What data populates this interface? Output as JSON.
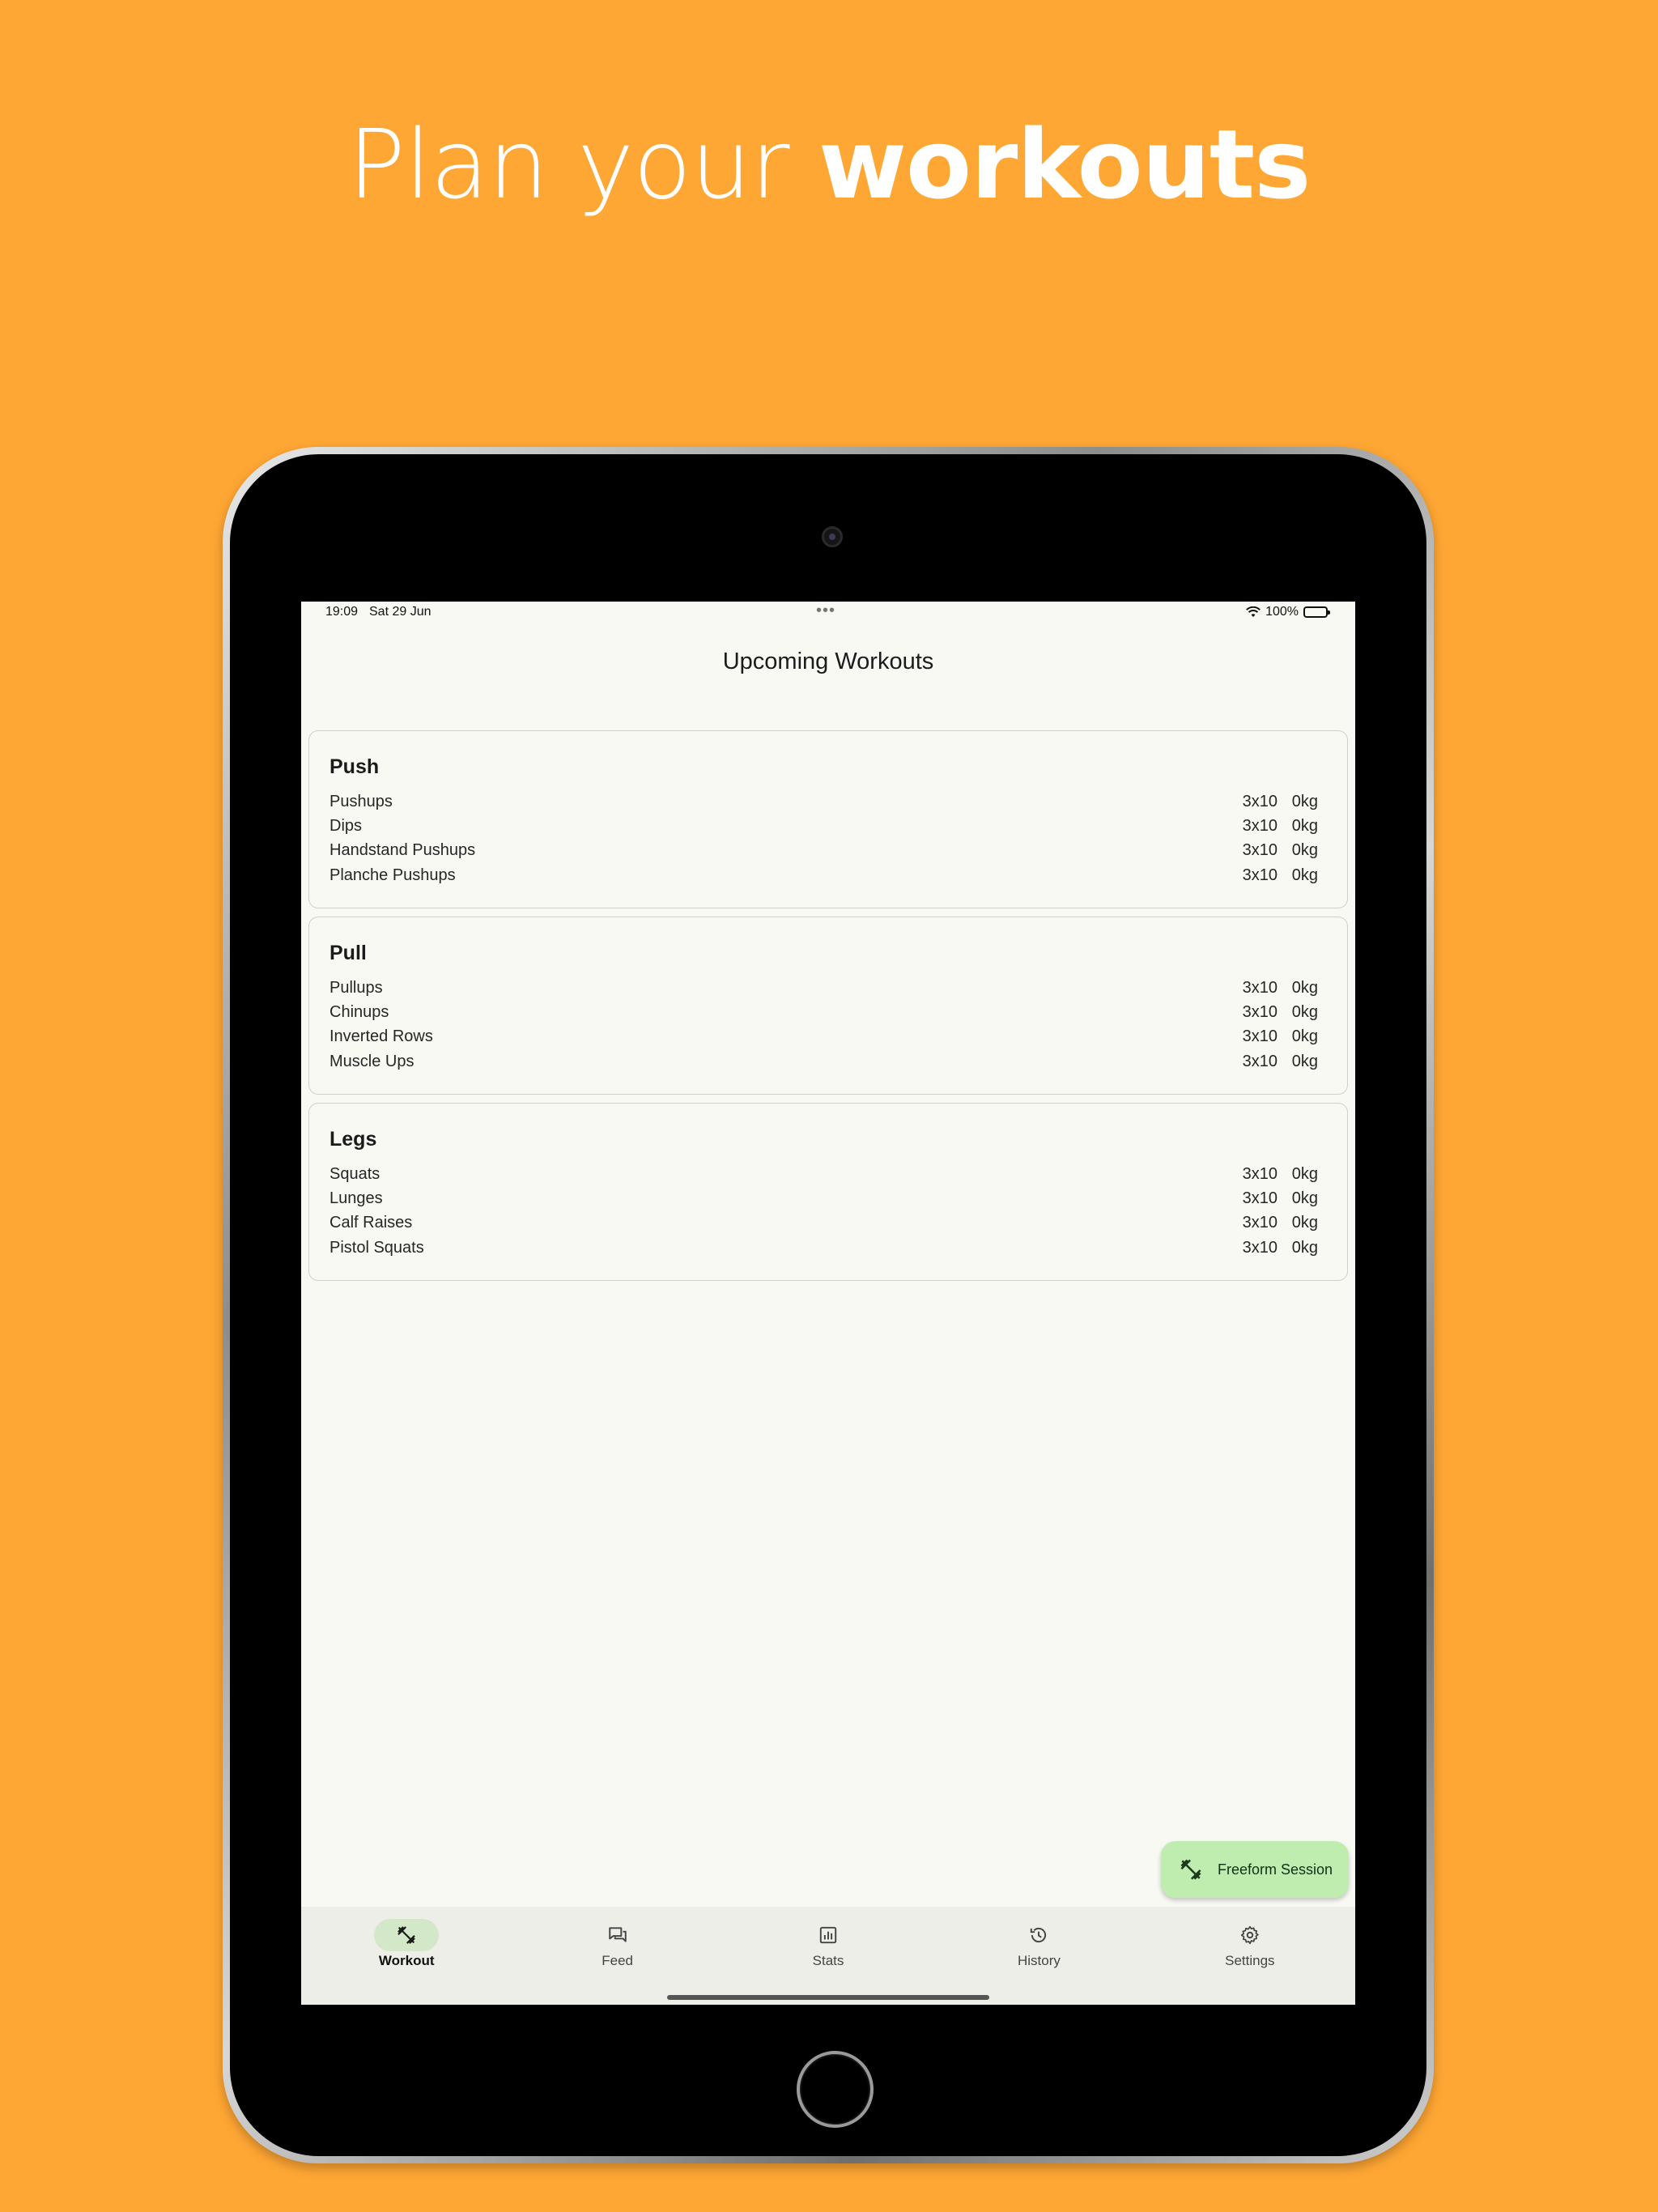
{
  "headline": {
    "light": "Plan your ",
    "bold": "workouts"
  },
  "status_bar": {
    "time": "19:09",
    "date": "Sat 29 Jun",
    "dots": "•••",
    "battery": "100%"
  },
  "screen_title": "Upcoming Workouts",
  "workouts": [
    {
      "name": "Push",
      "exercises": [
        {
          "name": "Pushups",
          "sets": "3x10",
          "weight": "0kg"
        },
        {
          "name": "Dips",
          "sets": "3x10",
          "weight": "0kg"
        },
        {
          "name": "Handstand Pushups",
          "sets": "3x10",
          "weight": "0kg"
        },
        {
          "name": "Planche Pushups",
          "sets": "3x10",
          "weight": "0kg"
        }
      ]
    },
    {
      "name": "Pull",
      "exercises": [
        {
          "name": "Pullups",
          "sets": "3x10",
          "weight": "0kg"
        },
        {
          "name": "Chinups",
          "sets": "3x10",
          "weight": "0kg"
        },
        {
          "name": "Inverted Rows",
          "sets": "3x10",
          "weight": "0kg"
        },
        {
          "name": "Muscle Ups",
          "sets": "3x10",
          "weight": "0kg"
        }
      ]
    },
    {
      "name": "Legs",
      "exercises": [
        {
          "name": "Squats",
          "sets": "3x10",
          "weight": "0kg"
        },
        {
          "name": "Lunges",
          "sets": "3x10",
          "weight": "0kg"
        },
        {
          "name": "Calf Raises",
          "sets": "3x10",
          "weight": "0kg"
        },
        {
          "name": "Pistol Squats",
          "sets": "3x10",
          "weight": "0kg"
        }
      ]
    }
  ],
  "fab": {
    "label": "Freeform Session",
    "icon": "dumbbell-icon"
  },
  "nav": [
    {
      "label": "Workout",
      "icon": "dumbbell-icon",
      "active": true
    },
    {
      "label": "Feed",
      "icon": "forum-icon",
      "active": false
    },
    {
      "label": "Stats",
      "icon": "bar-chart-icon",
      "active": false
    },
    {
      "label": "History",
      "icon": "history-icon",
      "active": false
    },
    {
      "label": "Settings",
      "icon": "gear-icon",
      "active": false
    }
  ],
  "colors": {
    "background": "#FFA734",
    "screen": "#F9F9F4",
    "fab": "#BFEDB0",
    "nav_active": "#D3E8C8"
  }
}
